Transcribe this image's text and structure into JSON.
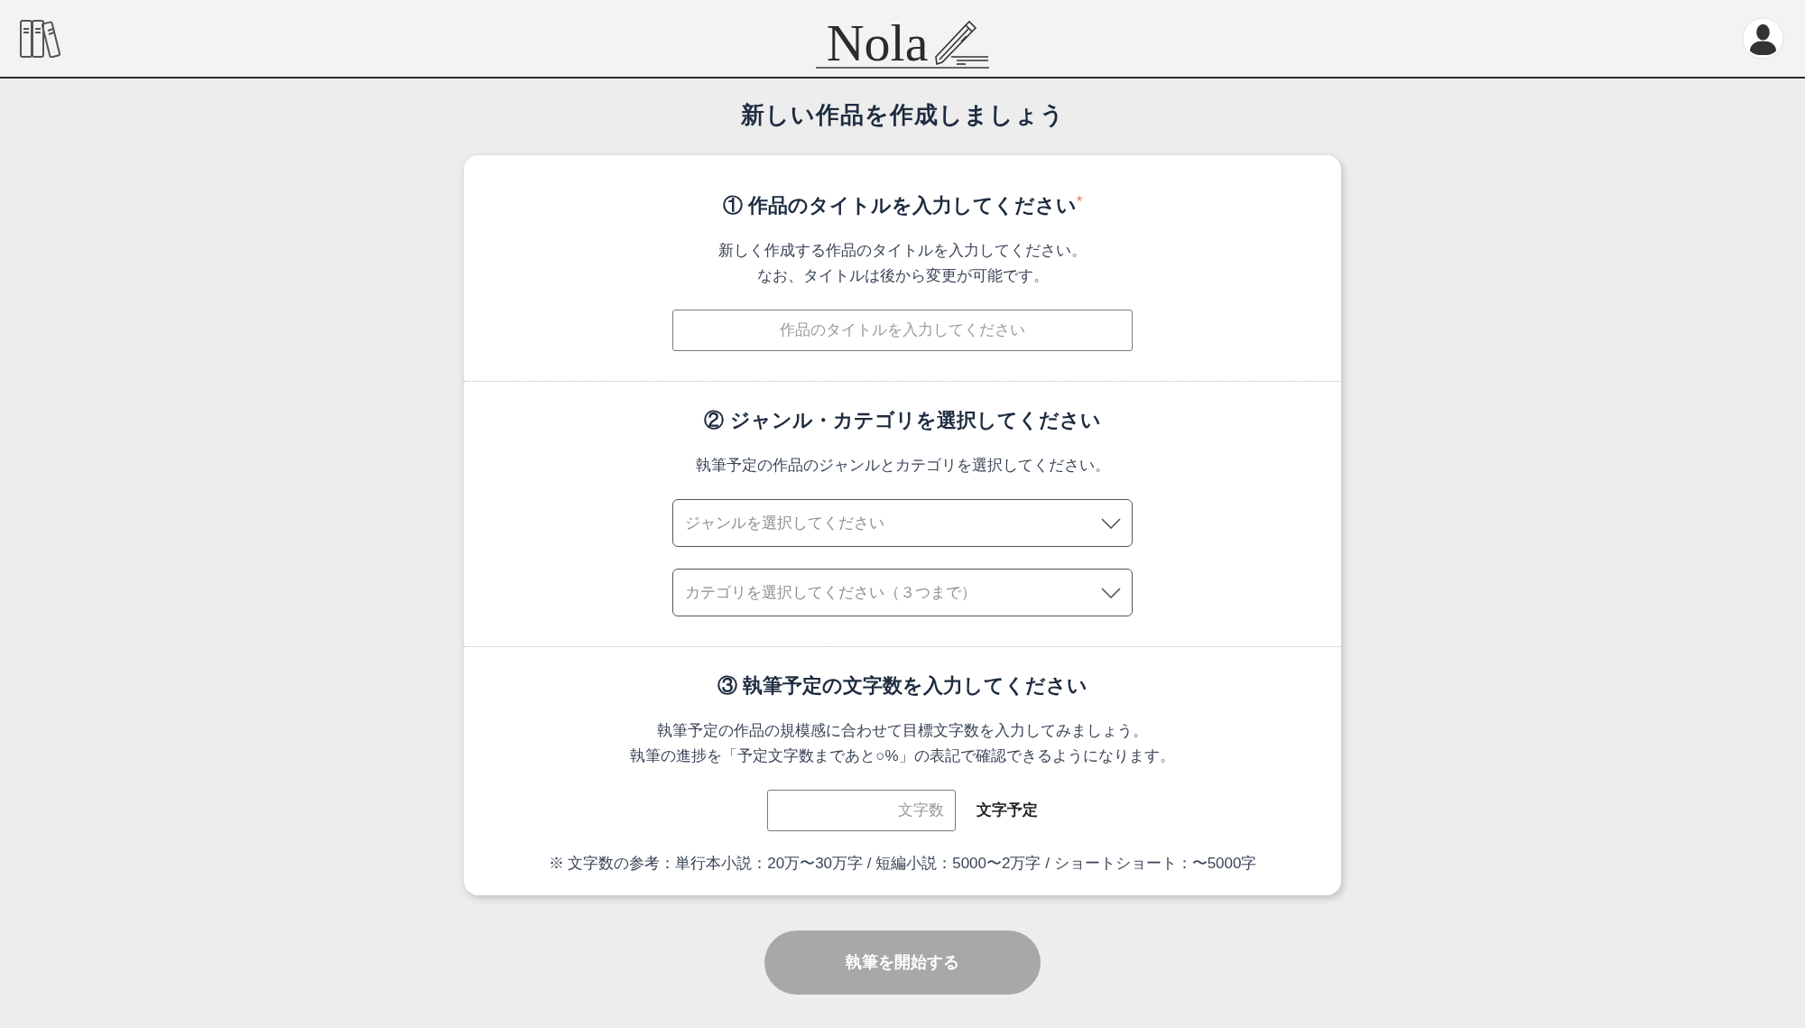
{
  "header": {
    "logo": "Nola"
  },
  "page_title": "新しい作品を作成しましょう",
  "sections": [
    {
      "heading": "① 作品のタイトルを入力してください",
      "required_mark": "*",
      "description": [
        "新しく作成する作品のタイトルを入力してください。",
        "なお、タイトルは後から変更が可能です。"
      ],
      "fields": [
        {
          "kind": "text",
          "placeholder": "作品のタイトルを入力してください"
        }
      ]
    },
    {
      "heading": "② ジャンル・カテゴリを選択してください",
      "description": [
        "執筆予定の作品のジャンルとカテゴリを選択してください。"
      ],
      "fields": [
        {
          "kind": "select",
          "placeholder": "ジャンルを選択してください"
        },
        {
          "kind": "select",
          "placeholder": "カテゴリを選択してください（３つまで）"
        }
      ]
    },
    {
      "heading": "③ 執筆予定の文字数を入力してください",
      "description": [
        "執筆予定の作品の規模感に合わせて目標文字数を入力してみましょう。",
        "執筆の進捗を「予定文字数まであと○%」の表記で確認できるようになります。"
      ],
      "fields": [
        {
          "kind": "number",
          "placeholder": "文字数",
          "suffix": "文字予定"
        }
      ],
      "note": "※ 文字数の参考：単行本小説：20万〜30万字 / 短編小説：5000〜2万字 / ショートショート：〜5000字"
    }
  ],
  "submit_button": {
    "label": "執筆を開始する",
    "disabled": true
  }
}
